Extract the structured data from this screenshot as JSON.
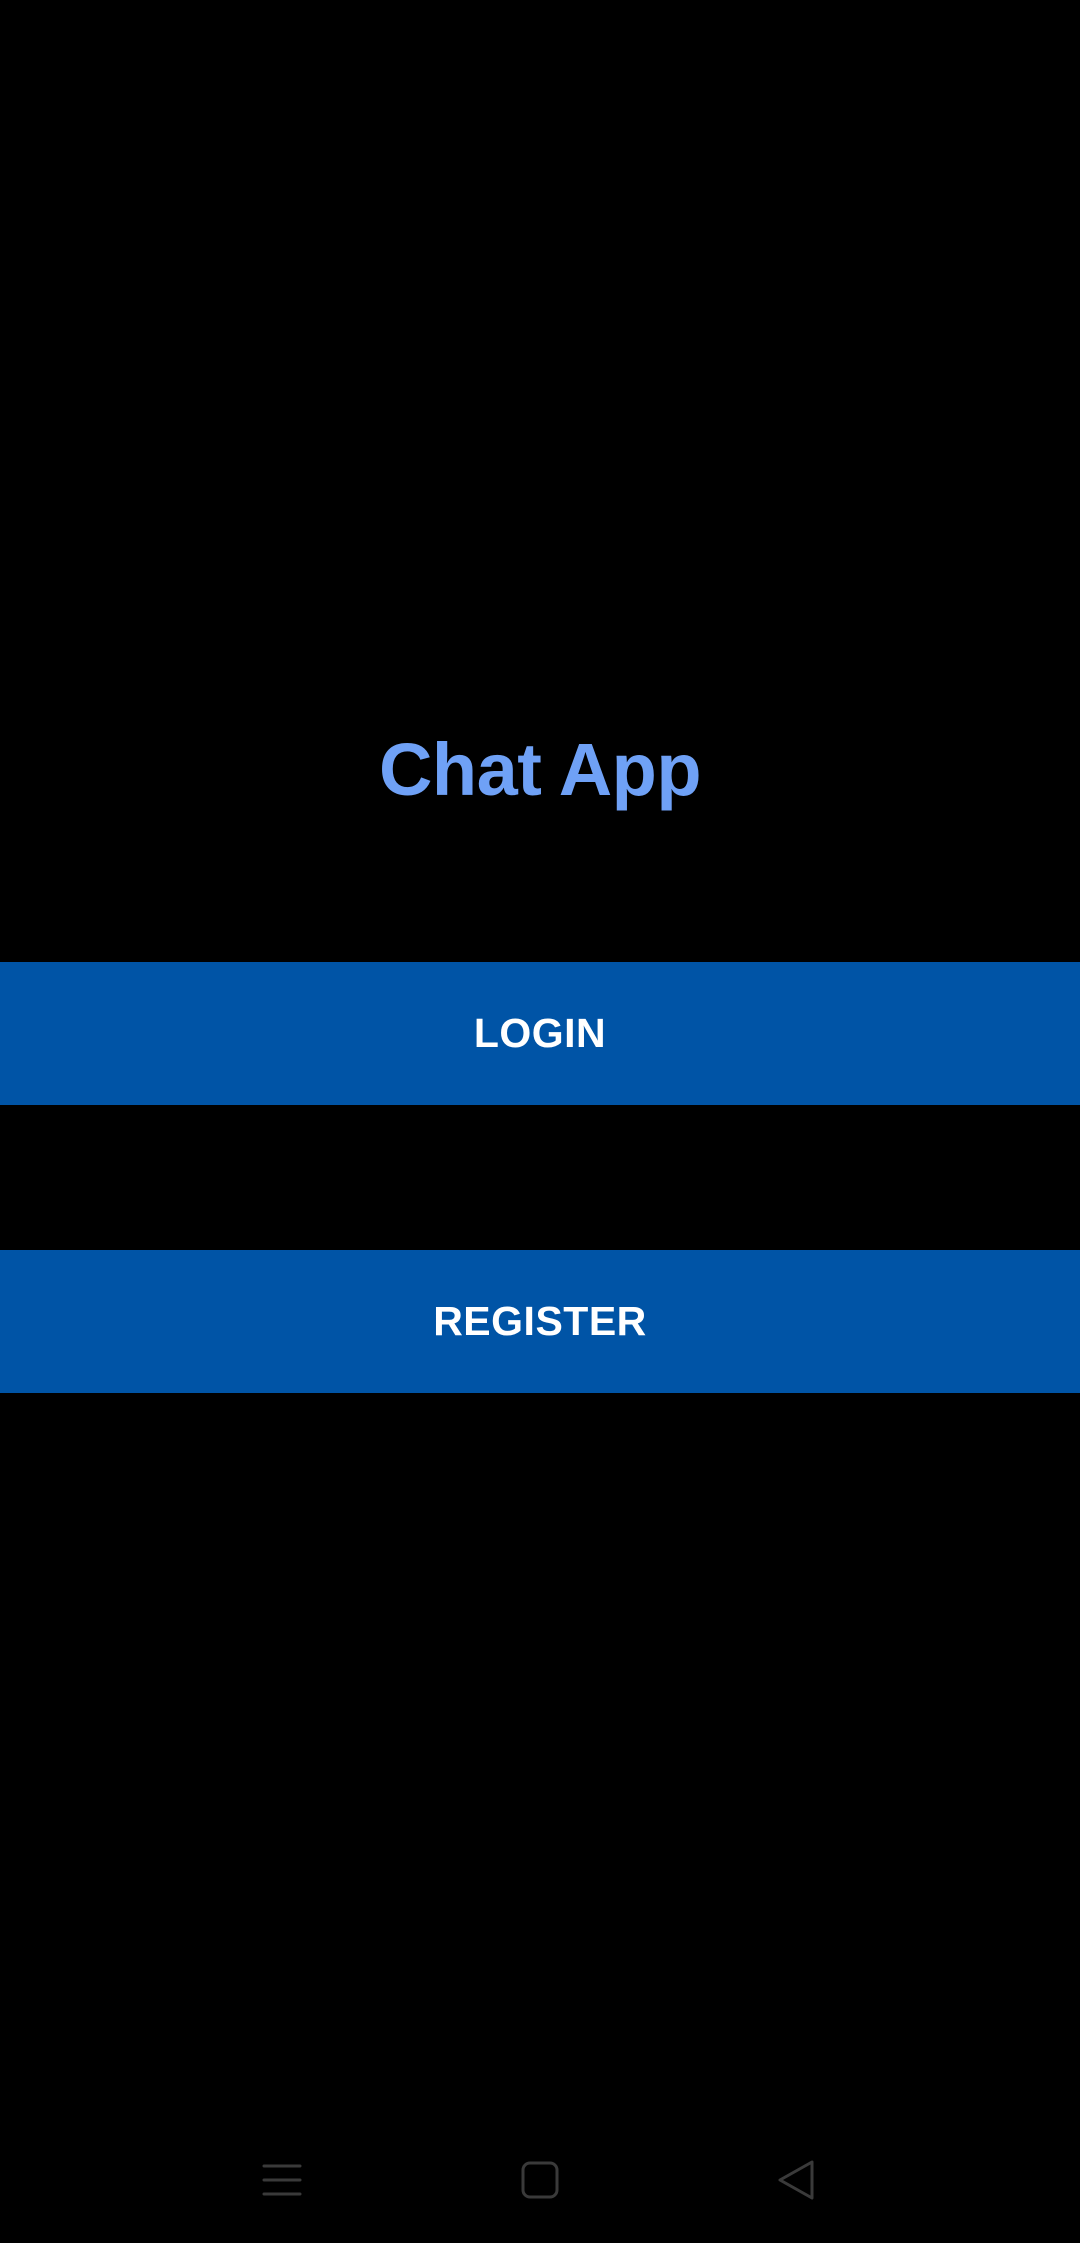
{
  "app": {
    "title": "Chat App"
  },
  "buttons": {
    "login_label": "LOGIN",
    "register_label": "REGISTER"
  },
  "nav_bar": {
    "icons": [
      "menu-icon",
      "home-icon",
      "back-icon"
    ]
  },
  "colors": {
    "background": "#000000",
    "title": "#6fa1f6",
    "button_background": "#0054a6",
    "button_text": "#ffffff",
    "nav_icon": "#3a3a3a"
  }
}
